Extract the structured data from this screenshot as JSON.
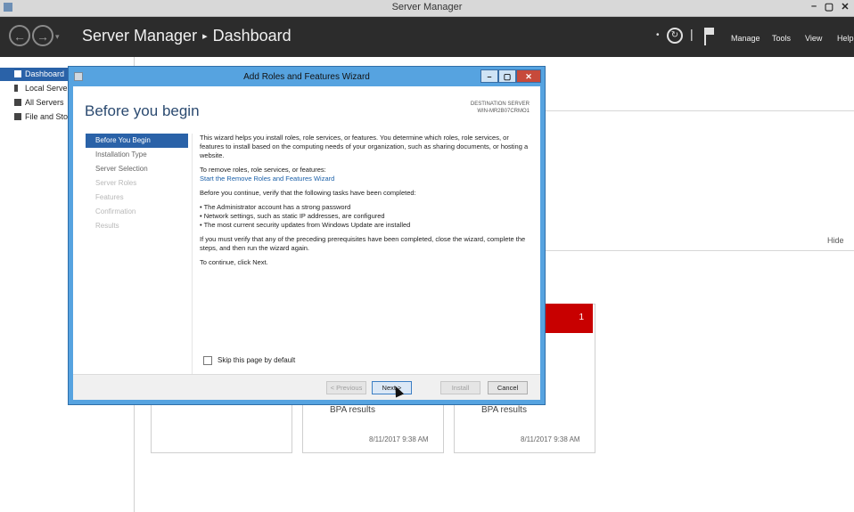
{
  "window": {
    "title": "Server Manager",
    "controls": [
      "–",
      "▢",
      "✕"
    ]
  },
  "header": {
    "breadcrumb_app": "Server Manager",
    "breadcrumb_sep": "▸",
    "breadcrumb_page": "Dashboard",
    "back_icon": "back-arrow-icon",
    "forward_icon": "forward-arrow-icon",
    "menu": [
      "Manage",
      "Tools",
      "View",
      "Help"
    ]
  },
  "sidebar": {
    "items": [
      {
        "label": "Dashboard",
        "icon": "dashboard-icon"
      },
      {
        "label": "Local Server",
        "icon": "server-icon"
      },
      {
        "label": "All Servers",
        "icon": "servers-icon"
      },
      {
        "label": "File and Storage Services",
        "icon": "storage-icon"
      }
    ]
  },
  "background": {
    "hide_label": "Hide",
    "tile_badge_count": "1",
    "tiles": [
      {
        "bpa": "BPA results",
        "timestamp": "8/11/2017 9:38 AM"
      },
      {
        "bpa": "BPA results",
        "timestamp": "8/11/2017 9:38 AM"
      }
    ]
  },
  "wizard": {
    "title": "Add Roles and Features Wizard",
    "heading": "Before you begin",
    "destination_label": "DESTINATION SERVER",
    "destination_server": "WIN-MR2B07CRMO1",
    "steps": [
      {
        "label": "Before You Begin",
        "state": "active"
      },
      {
        "label": "Installation Type",
        "state": "normal"
      },
      {
        "label": "Server Selection",
        "state": "normal"
      },
      {
        "label": "Server Roles",
        "state": "dim"
      },
      {
        "label": "Features",
        "state": "dim"
      },
      {
        "label": "Confirmation",
        "state": "dim"
      },
      {
        "label": "Results",
        "state": "dim"
      }
    ],
    "intro": "This wizard helps you install roles, role services, or features. You determine which roles, role services, or features to install based on the computing needs of your organization, such as sharing documents, or hosting a website.",
    "remove_text": "To remove roles, role services, or features:",
    "remove_link": "Start the Remove Roles and Features Wizard",
    "verify_text": "Before you continue, verify that the following tasks have been completed:",
    "tasks": [
      "The Administrator account has a strong password",
      "Network settings, such as static IP addresses, are configured",
      "The most current security updates from Windows Update are installed"
    ],
    "prereq_text": "If you must verify that any of the preceding prerequisites have been completed, close the wizard, complete the steps, and then run the wizard again.",
    "continue_text": "To continue, click Next.",
    "skip_label": "Skip this page by default",
    "buttons": {
      "previous": "< Previous",
      "next": "Next >",
      "install": "Install",
      "cancel": "Cancel"
    }
  }
}
